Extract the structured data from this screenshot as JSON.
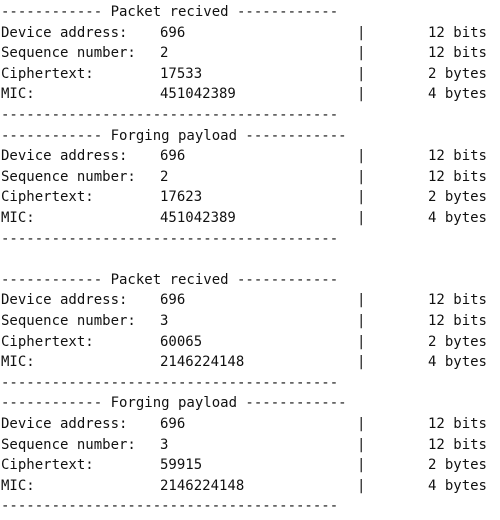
{
  "lines": [
    {
      "kind": "header",
      "text": "------------ Packet recived ------------"
    },
    {
      "kind": "field",
      "label": "Device address:",
      "value": "696",
      "bar": "|",
      "size": "12 bits"
    },
    {
      "kind": "field",
      "label": "Sequence number:",
      "value": "2",
      "bar": "|",
      "size": "12 bits"
    },
    {
      "kind": "field",
      "label": "Ciphertext:",
      "value": "17533",
      "bar": "|",
      "size": "2 bytes"
    },
    {
      "kind": "field",
      "label": "MIC:",
      "value": "451042389",
      "bar": "|",
      "size": "4 bytes"
    },
    {
      "kind": "rule",
      "text": "----------------------------------------"
    },
    {
      "kind": "header",
      "text": "------------ Forging payload ------------"
    },
    {
      "kind": "field",
      "label": "Device address:",
      "value": "696",
      "bar": "|",
      "size": "12 bits"
    },
    {
      "kind": "field",
      "label": "Sequence number:",
      "value": "2",
      "bar": "|",
      "size": "12 bits"
    },
    {
      "kind": "field",
      "label": "Ciphertext:",
      "value": "17623",
      "bar": "|",
      "size": "2 bytes"
    },
    {
      "kind": "field",
      "label": "MIC:",
      "value": "451042389",
      "bar": "|",
      "size": "4 bytes"
    },
    {
      "kind": "rule",
      "text": "----------------------------------------"
    },
    {
      "kind": "blank",
      "text": ""
    },
    {
      "kind": "header",
      "text": "------------ Packet recived ------------"
    },
    {
      "kind": "field",
      "label": "Device address:",
      "value": "696",
      "bar": "|",
      "size": "12 bits"
    },
    {
      "kind": "field",
      "label": "Sequence number:",
      "value": "3",
      "bar": "|",
      "size": "12 bits"
    },
    {
      "kind": "field",
      "label": "Ciphertext:",
      "value": "60065",
      "bar": "|",
      "size": "2 bytes"
    },
    {
      "kind": "field",
      "label": "MIC:",
      "value": "2146224148",
      "bar": "|",
      "size": "4 bytes"
    },
    {
      "kind": "rule",
      "text": "----------------------------------------"
    },
    {
      "kind": "header",
      "text": "------------ Forging payload ------------"
    },
    {
      "kind": "field",
      "label": "Device address:",
      "value": "696",
      "bar": "|",
      "size": "12 bits"
    },
    {
      "kind": "field",
      "label": "Sequence number:",
      "value": "3",
      "bar": "|",
      "size": "12 bits"
    },
    {
      "kind": "field",
      "label": "Ciphertext:",
      "value": "59915",
      "bar": "|",
      "size": "2 bytes"
    },
    {
      "kind": "field",
      "label": "MIC:",
      "value": "2146224148",
      "bar": "|",
      "size": "4 bytes"
    },
    {
      "kind": "rule",
      "text": "----------------------------------------"
    }
  ]
}
